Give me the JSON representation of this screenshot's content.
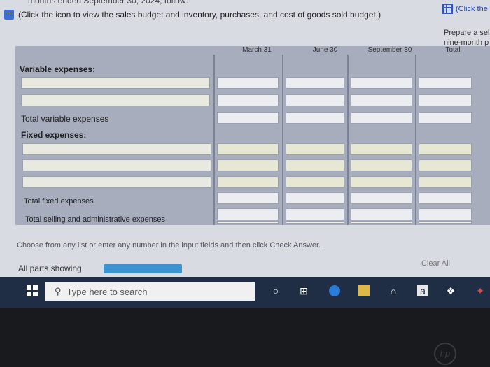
{
  "top": {
    "cutoff_line": "months ended September 30, 2024, follow:",
    "instruction": "(Click the icon to view the sales budget and inventory, purchases, and cost of goods sold budget.)",
    "right_link": "(Click the",
    "prepare_line1": "Prepare a sel",
    "prepare_line2": "nine-month p"
  },
  "table": {
    "headers": [
      "March 31",
      "June 30",
      "September 30",
      "Total"
    ],
    "variable_label": "Variable expenses:",
    "total_variable_label": "Total variable expenses",
    "fixed_label": "Fixed expenses:",
    "total_fixed_label": "Total fixed expenses",
    "total_sga_label": "Total selling and administrative expenses"
  },
  "footer": {
    "instruction": "Choose from any list or enter any number in the input fields and then click Check Answer.",
    "parts": "All parts showing",
    "clear": "Clear All"
  },
  "taskbar": {
    "search_placeholder": "Type here to search"
  },
  "colors": {
    "accent": "#3c93cf",
    "taskbar": "#1f2d45",
    "table_bg": "#a8adbd"
  }
}
